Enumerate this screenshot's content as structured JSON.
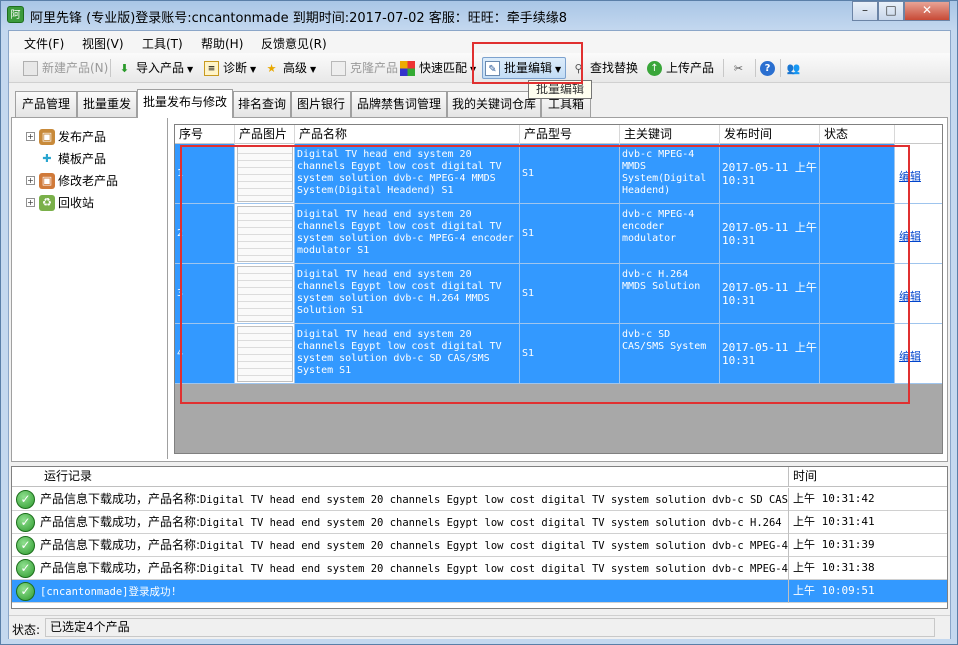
{
  "window": {
    "title": "阿里先锋 (专业版)登录账号:cncantonmade  到期时间:2017-07-02  客服：旺旺：牵手续缘8",
    "app_icon_text": "阿",
    "controls": {
      "minimize": "–",
      "maximize": "□",
      "close": "✕"
    }
  },
  "menu": [
    "文件(F)",
    "视图(V)",
    "工具(T)",
    "帮助(H)",
    "反馈意见(R)"
  ],
  "toolbar": {
    "new_product": "新建产品(N)",
    "import_product": "导入产品",
    "diagnose": "诊断",
    "advanced": "高级",
    "clone_product": "克隆产品",
    "quick_match": "快速匹配",
    "batch_edit": "批量编辑",
    "find_replace": "查找替换",
    "upload_product": "上传产品"
  },
  "tabs": [
    "产品管理",
    "批量重发",
    "批量发布与修改",
    "排名查询",
    "图片银行",
    "品牌禁售词管理",
    "我的关键词仓库",
    "工具箱"
  ],
  "tooltip": "批量编辑",
  "tree": [
    "发布产品",
    "模板产品",
    "修改老产品",
    "回收站"
  ],
  "grid": {
    "headers": [
      "序号",
      "产品图片",
      "产品名称",
      "产品型号",
      "主关键词",
      "发布时间",
      "状态"
    ],
    "edit_label": "编辑",
    "rows": [
      {
        "no": "1",
        "name": "Digital TV head end system 20 channels Egypt low cost digital TV system solution dvb-c MPEG-4 MMDS System(Digital Headend) S1",
        "model": "S1",
        "keyword": "dvb-c MPEG-4 MMDS System(Digital Headend)",
        "time": "2017-05-11 上午 10:31",
        "status": ""
      },
      {
        "no": "2",
        "name": "Digital TV head end system 20 channels Egypt low cost digital TV system solution dvb-c MPEG-4 encoder modulator S1",
        "model": "S1",
        "keyword": "dvb-c MPEG-4 encoder modulator",
        "time": "2017-05-11 上午 10:31",
        "status": ""
      },
      {
        "no": "3",
        "name": "Digital TV head end system 20 channels Egypt low cost digital TV system solution dvb-c H.264 MMDS Solution S1",
        "model": "S1",
        "keyword": "dvb-c H.264 MMDS Solution",
        "time": "2017-05-11 上午 10:31",
        "status": ""
      },
      {
        "no": "4",
        "name": "Digital TV head end system 20 channels Egypt low cost digital TV system solution dvb-c SD CAS/SMS System S1",
        "model": "S1",
        "keyword": "dvb-c SD CAS/SMS System",
        "time": "2017-05-11 上午 10:31",
        "status": ""
      }
    ]
  },
  "log": {
    "headers": [
      "运行记录",
      "时间"
    ],
    "rows": [
      {
        "prefix": "产品信息下载成功，产品名称:",
        "text": "Digital TV head end system 20 channels Egypt low cost digital TV system solution dvb-c SD CAS/...",
        "time": "上午 10:31:42"
      },
      {
        "prefix": "产品信息下载成功，产品名称:",
        "text": "Digital TV head end system 20 channels Egypt low cost digital TV system solution dvb-c H.264 M...",
        "time": "上午 10:31:41"
      },
      {
        "prefix": "产品信息下载成功，产品名称:",
        "text": "Digital TV head end system 20 channels Egypt low cost digital TV system solution dvb-c MPEG-4 ...",
        "time": "上午 10:31:39"
      },
      {
        "prefix": "产品信息下载成功，产品名称:",
        "text": "Digital TV head end system 20 channels Egypt low cost digital TV system solution dvb-c MPEG-4 ...",
        "time": "上午 10:31:38"
      },
      {
        "prefix": "",
        "text": "[cncantonmade]登录成功!",
        "time": "上午 10:09:51"
      }
    ]
  },
  "status": {
    "label": "状态:",
    "value": "已选定4个产品"
  },
  "colors": {
    "selection": "#3399ff",
    "highlight_box": "#e03030",
    "titlebar": "#a9c6e6"
  }
}
